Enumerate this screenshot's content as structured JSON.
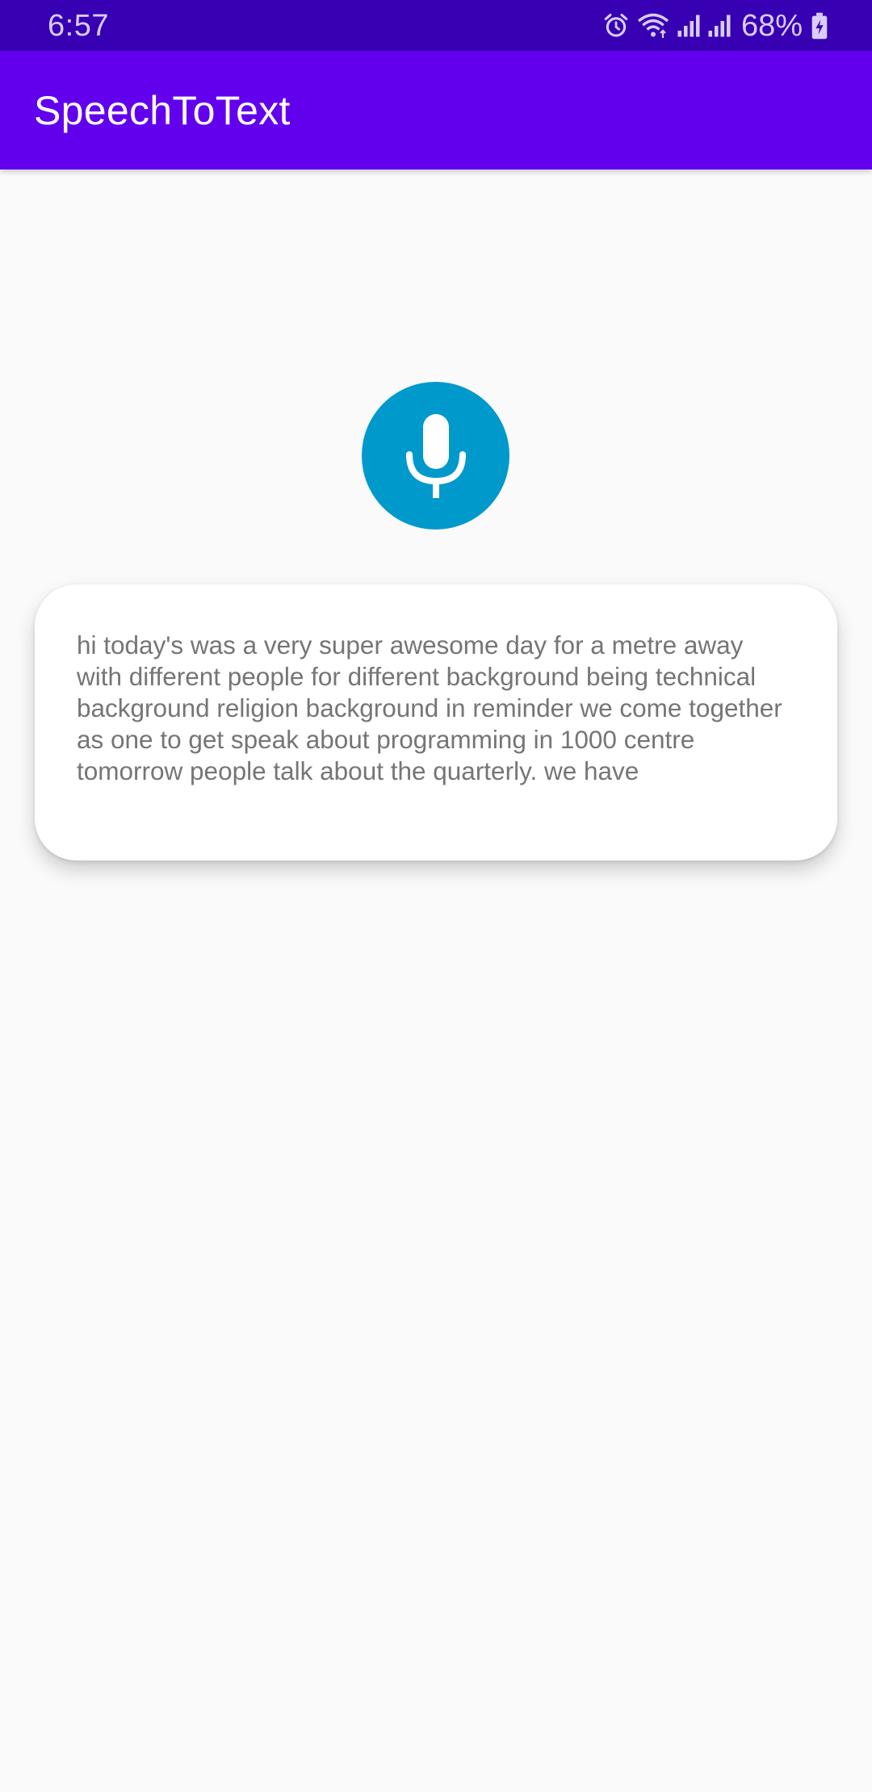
{
  "status_bar": {
    "time": "6:57",
    "battery_percent": "68%",
    "icons": [
      "alarm-icon",
      "wifi-icon",
      "signal-icon",
      "signal-icon",
      "battery-charging-icon"
    ]
  },
  "app_bar": {
    "title": "SpeechToText",
    "color": "#6200ee"
  },
  "mic_button": {
    "icon": "microphone-icon",
    "color": "#0099cc"
  },
  "transcript": {
    "text": "hi today's was a very super awesome day for a metre away with different people for different background being technical background religion background in reminder we come together as one to get speak about programming in 1000 centre tomorrow people talk about the quarterly. we have"
  }
}
